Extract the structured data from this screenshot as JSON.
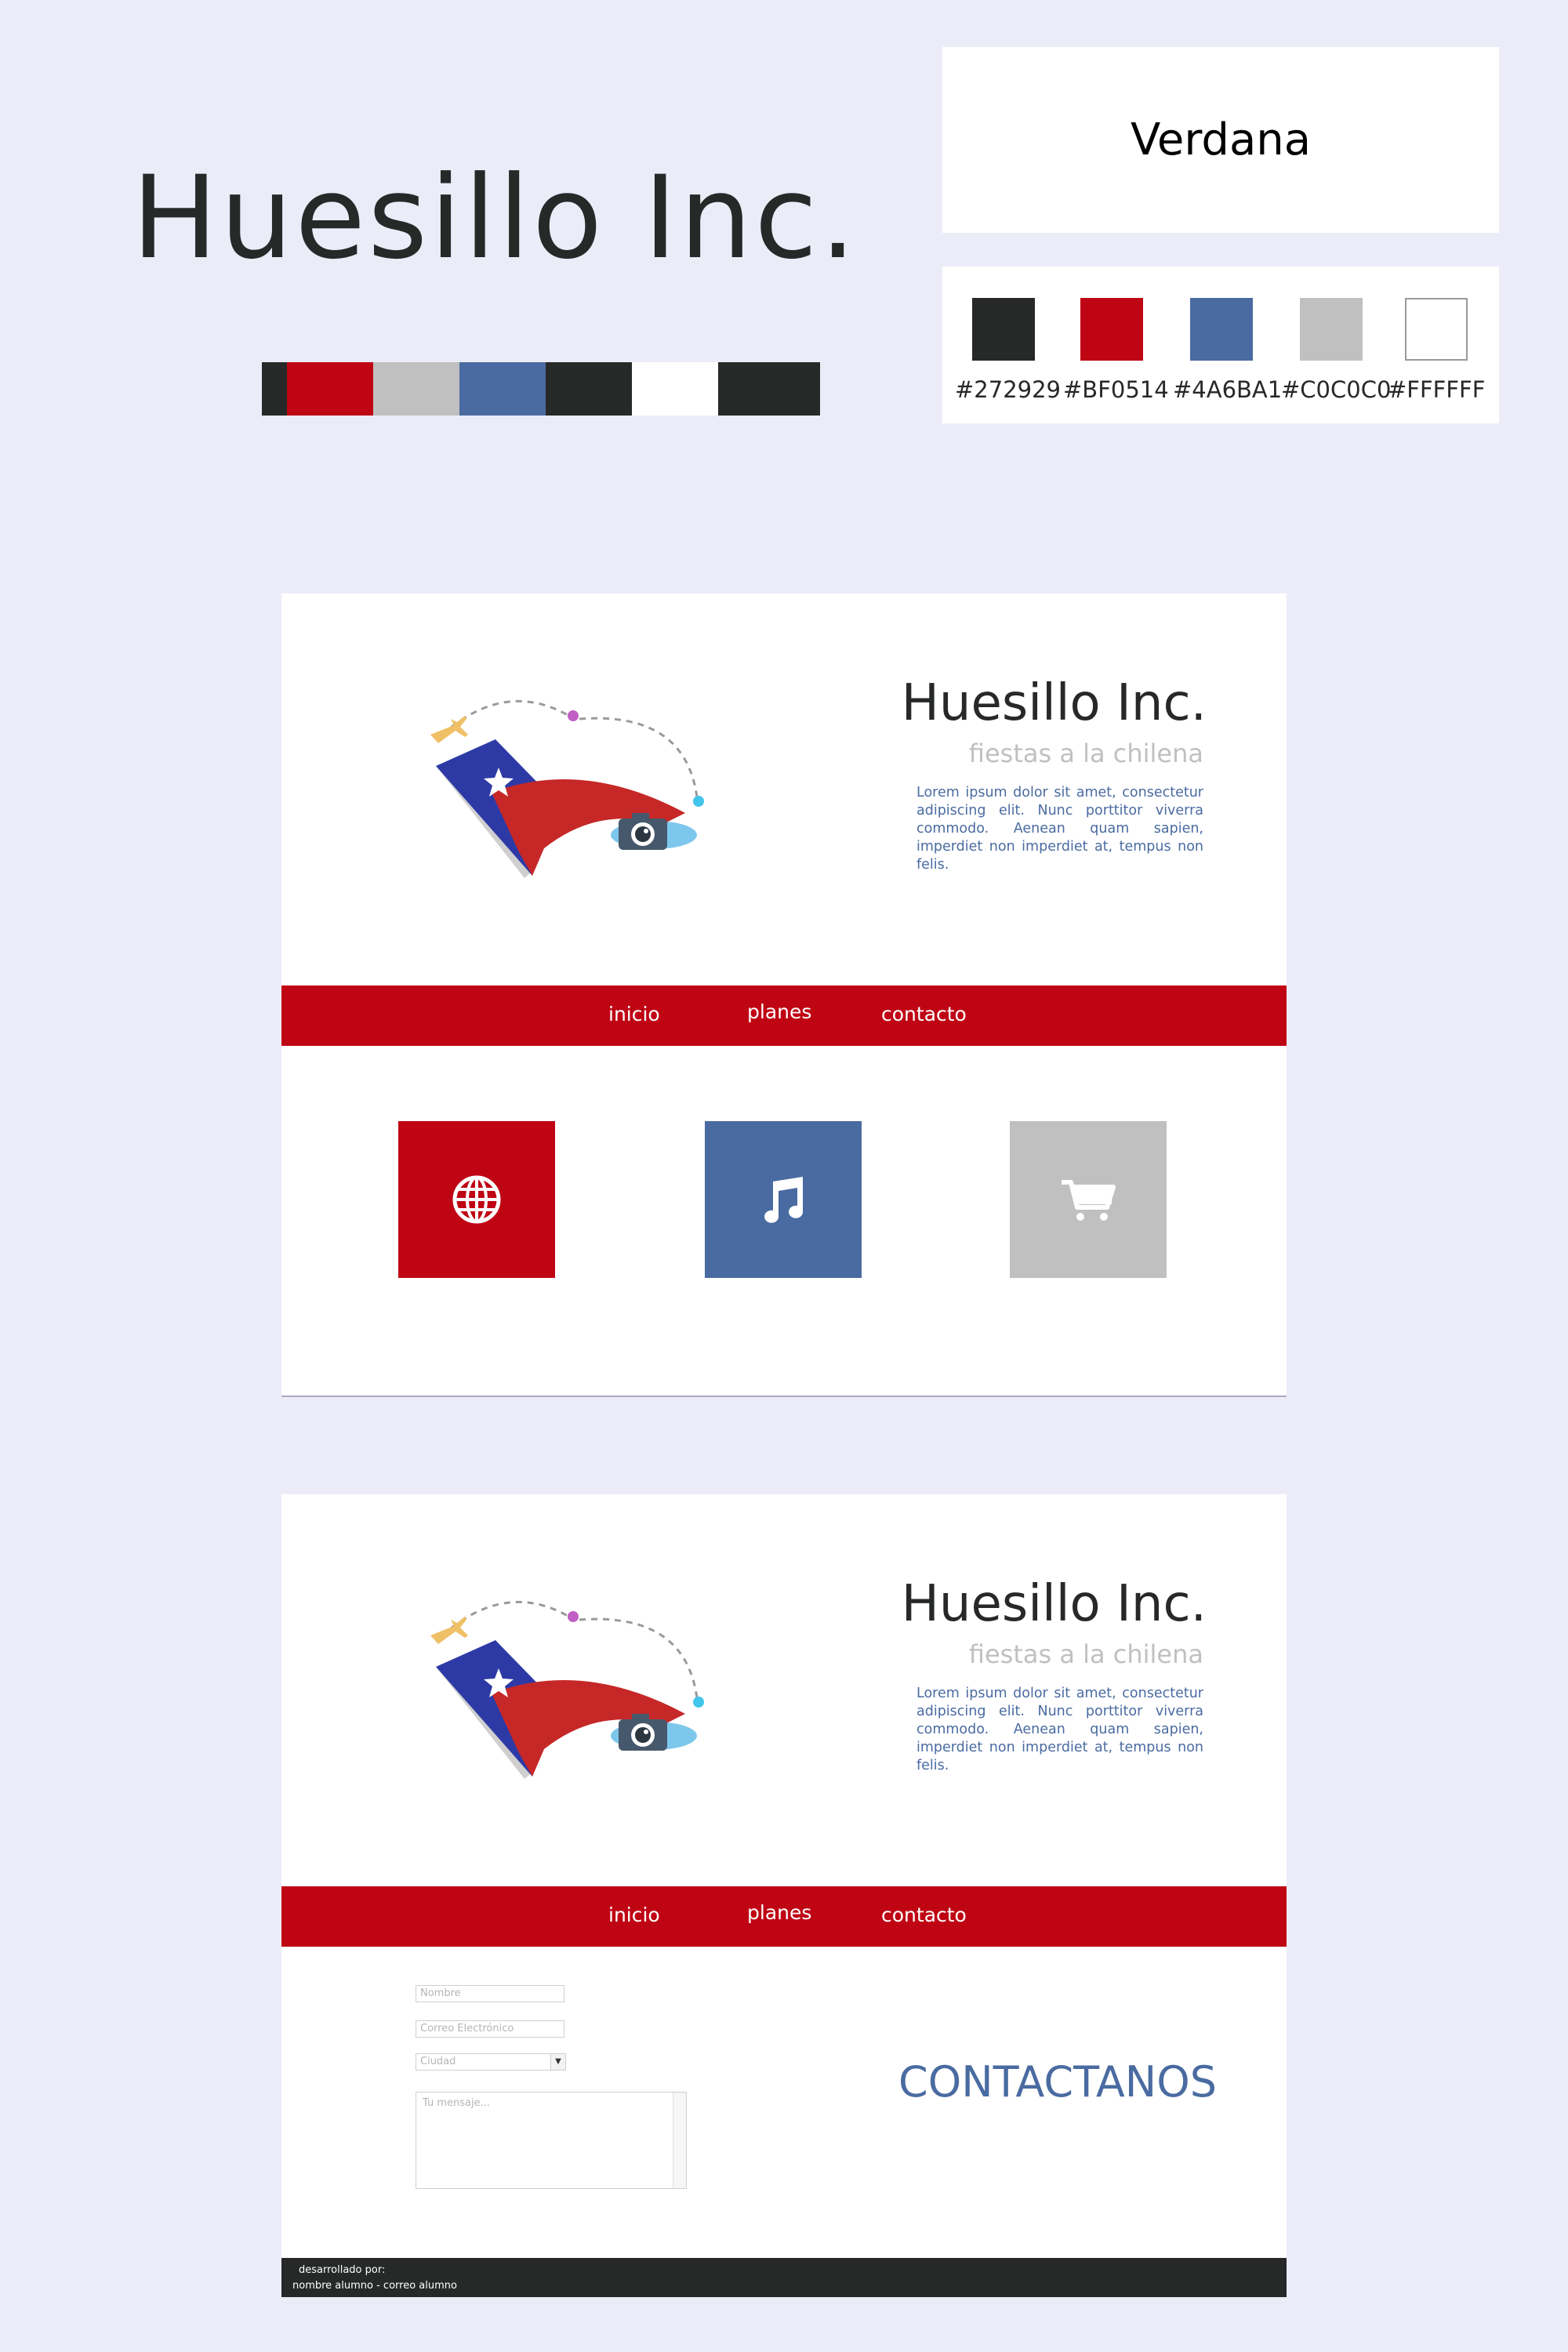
{
  "brand": {
    "title": "Huesillo Inc."
  },
  "font_card": {
    "font_name": "Verdana"
  },
  "palette_strip": [
    "#272929",
    "#BF0514",
    "#C0C0C0",
    "#4A6BA1",
    "#272929",
    "#FFFFFF",
    "#272929"
  ],
  "swatches": [
    {
      "color": "#272929",
      "code": "#272929"
    },
    {
      "color": "#BF0514",
      "code": "#BF0514"
    },
    {
      "color": "#4A6BA1",
      "code": "#4A6BA1"
    },
    {
      "color": "#C0C0C0",
      "code": "#C0C0C0"
    },
    {
      "color": "#FFFFFF",
      "code": "#FFFFFF"
    }
  ],
  "site": {
    "title": "Huesillo Inc.",
    "subtitle": "fiestas a la chilena",
    "lorem": "Lorem ipsum dolor sit amet, consectetur adipiscing elit. Nunc porttitor viverra commodo. Aenean quam sapien, imperdiet non imperdiet at, tempus non felis."
  },
  "nav": {
    "inicio": "inicio",
    "planes": "planes",
    "contacto": "contacto"
  },
  "tiles": [
    {
      "icon": "globe-icon",
      "color": "#BF0514"
    },
    {
      "icon": "music-note-icon",
      "color": "#4A6BA1"
    },
    {
      "icon": "shopping-cart-icon",
      "color": "#C0C0C0"
    }
  ],
  "contact_form": {
    "name_placeholder": "Nombre",
    "email_placeholder": "Correo Electrónico",
    "city_selected": "Ciudad",
    "message_placeholder": "Tu mensaje..."
  },
  "contact_heading": "CONTACTANOS",
  "footer": {
    "line1": "desarrollado por:",
    "line2": "nombre alumno - correo alumno"
  }
}
